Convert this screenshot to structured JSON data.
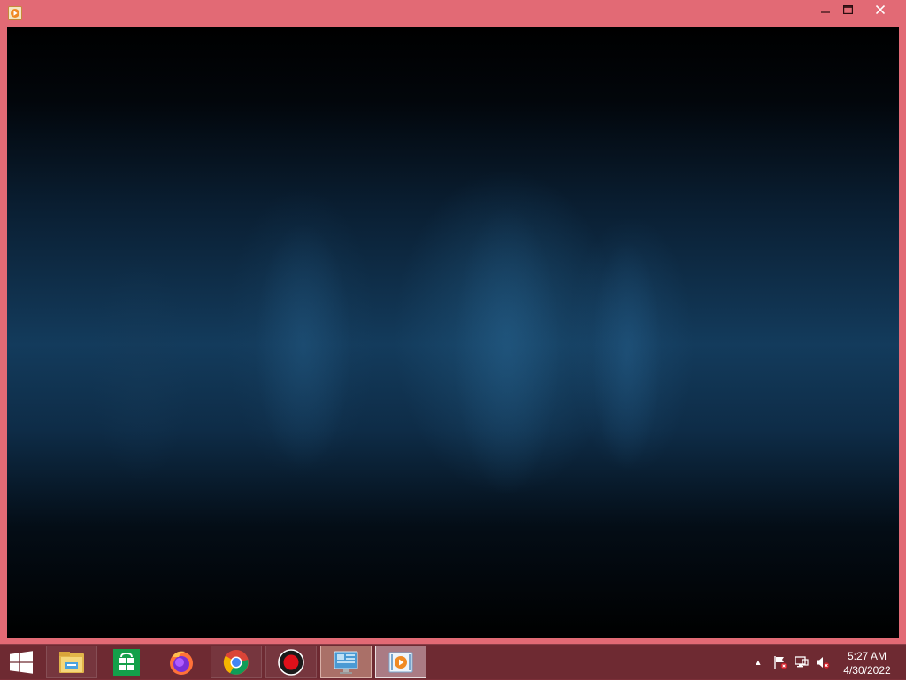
{
  "window": {
    "controls": {
      "minimize": "—",
      "maximize": "☐",
      "close": "✕"
    },
    "accent_color": "#e26a75"
  },
  "taskbar": {
    "background_color": "#6e2a32",
    "start_icon": "windows-logo-icon",
    "apps": [
      {
        "icon": "file-explorer-icon",
        "state": "pinned"
      },
      {
        "icon": "store-icon",
        "state": "pinned"
      },
      {
        "icon": "firefox-icon",
        "state": "pinned"
      },
      {
        "icon": "chrome-icon",
        "state": "pinned"
      },
      {
        "icon": "record-icon",
        "state": "pinned"
      },
      {
        "icon": "control-panel-icon",
        "state": "running"
      },
      {
        "icon": "media-player-icon",
        "state": "active"
      }
    ],
    "tray": {
      "chevron": "▲",
      "icons": [
        "action-center-flag-icon",
        "network-icon",
        "volume-muted-icon"
      ]
    },
    "clock": {
      "time": "5:27 AM",
      "date": "4/30/2022"
    }
  }
}
